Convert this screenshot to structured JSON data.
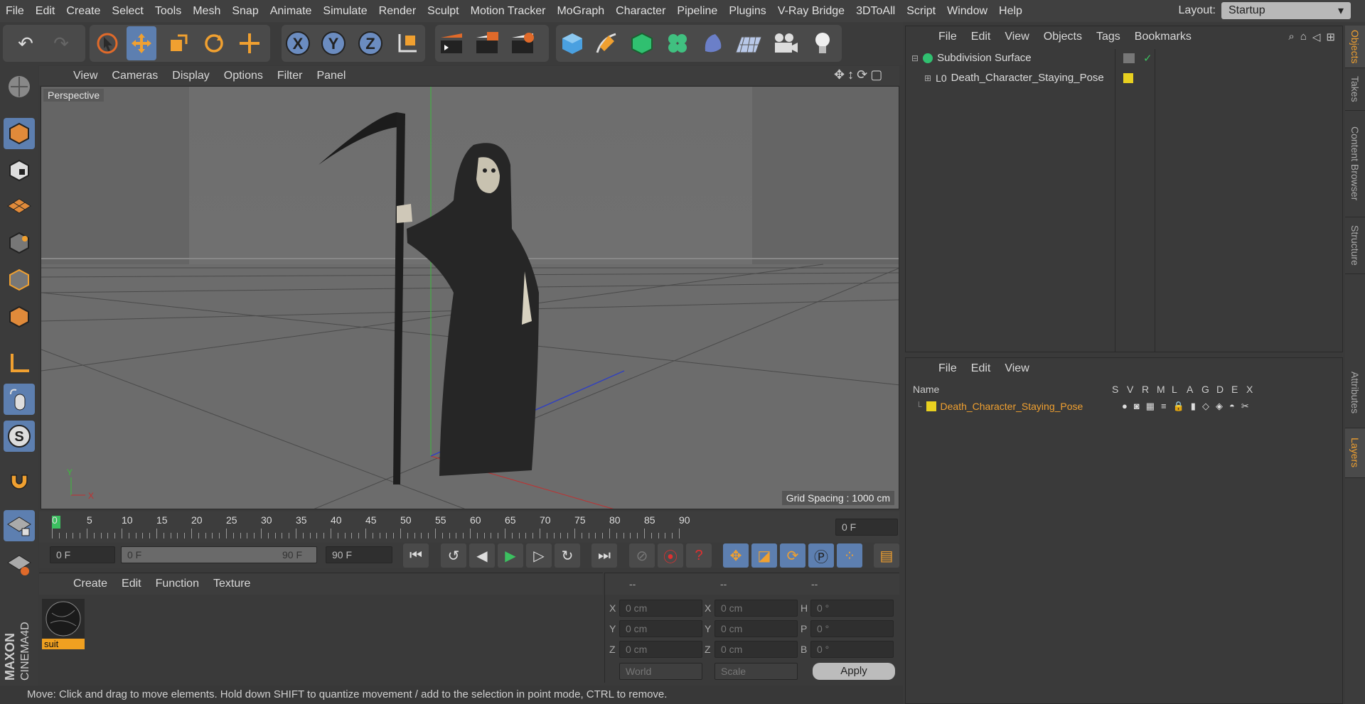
{
  "menubar": {
    "items": [
      "File",
      "Edit",
      "Create",
      "Select",
      "Tools",
      "Mesh",
      "Snap",
      "Animate",
      "Simulate",
      "Render",
      "Sculpt",
      "Motion Tracker",
      "MoGraph",
      "Character",
      "Pipeline",
      "Plugins",
      "V-Ray Bridge",
      "3DToAll",
      "Script",
      "Window",
      "Help"
    ],
    "layout_label": "Layout:",
    "layout_value": "Startup"
  },
  "viewport": {
    "menu": [
      "View",
      "Cameras",
      "Display",
      "Options",
      "Filter",
      "Panel"
    ],
    "camera_label": "Perspective",
    "grid_spacing": "Grid Spacing : 1000 cm"
  },
  "timeline": {
    "ticks": [
      "0",
      "5",
      "10",
      "15",
      "20",
      "25",
      "30",
      "35",
      "40",
      "45",
      "50",
      "55",
      "60",
      "65",
      "70",
      "75",
      "80",
      "85",
      "90"
    ],
    "current_frame": "0 F"
  },
  "playbar": {
    "start": "0 F",
    "range_start": "0 F",
    "range_end": "90 F",
    "end": "90 F"
  },
  "material_panel": {
    "menu": [
      "Create",
      "Edit",
      "Function",
      "Texture"
    ],
    "material_name": "suit"
  },
  "coordinates": {
    "headers": [
      "--",
      "--",
      "--"
    ],
    "rows": [
      {
        "l1": "X",
        "v1": "0 cm",
        "l2": "X",
        "v2": "0 cm",
        "l3": "H",
        "v3": "0 °"
      },
      {
        "l1": "Y",
        "v1": "0 cm",
        "l2": "Y",
        "v2": "0 cm",
        "l3": "P",
        "v3": "0 °"
      },
      {
        "l1": "Z",
        "v1": "0 cm",
        "l2": "Z",
        "v2": "0 cm",
        "l3": "B",
        "v3": "0 °"
      }
    ],
    "mode1": "World",
    "mode2": "Scale",
    "apply": "Apply"
  },
  "status_text": "Move: Click and drag to move elements. Hold down SHIFT to quantize movement / add to the selection in point mode, CTRL to remove.",
  "objects_panel": {
    "menu": [
      "File",
      "Edit",
      "View",
      "Objects",
      "Tags",
      "Bookmarks"
    ],
    "items": [
      "Subdivision Surface",
      "Death_Character_Staying_Pose"
    ]
  },
  "layers_panel": {
    "menu": [
      "File",
      "Edit",
      "View"
    ],
    "columns": [
      "Name",
      "S",
      "V",
      "R",
      "M",
      "L",
      "A",
      "G",
      "D",
      "E",
      "X"
    ],
    "layer_name": "Death_Character_Staying_Pose"
  },
  "side_tabs": [
    "Objects",
    "Takes",
    "Content Browser",
    "Structure",
    "Attributes",
    "Layers"
  ],
  "brand": {
    "maxon": "MAXON",
    "product": "CINEMA4D"
  },
  "colors": {
    "accent": "#5d7fb0",
    "orange": "#f0a030",
    "layer_yellow": "#e8d020",
    "playhead": "#3cc060"
  }
}
